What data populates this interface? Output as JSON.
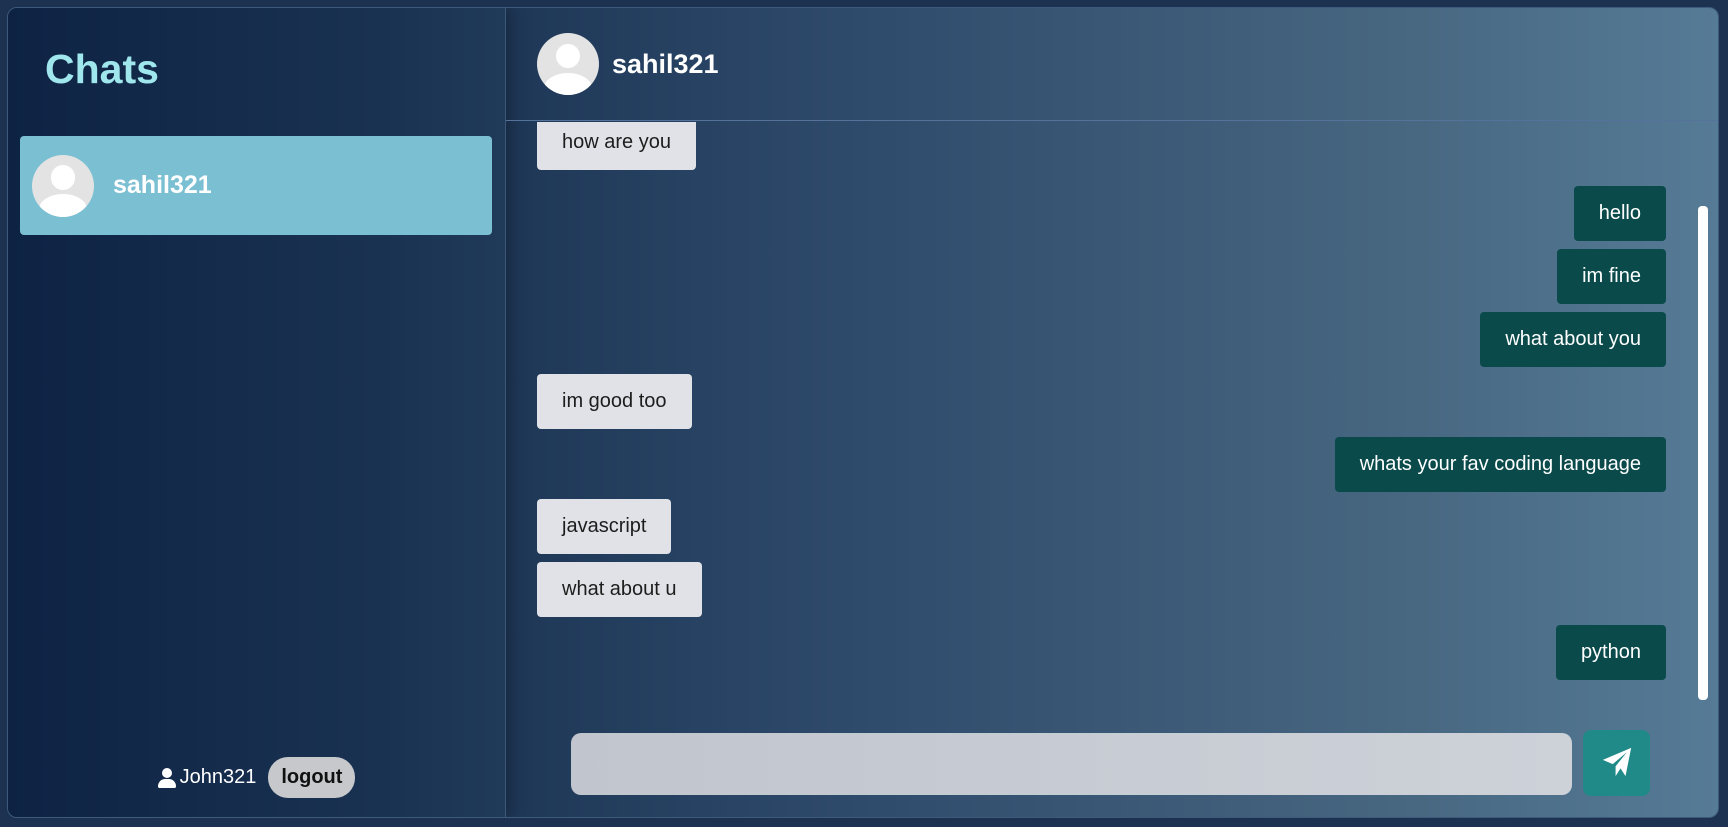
{
  "sidebar": {
    "title": "Chats",
    "chats": [
      {
        "name": "sahil321",
        "active": true
      }
    ],
    "footer": {
      "username": "John321",
      "logout_label": "logout"
    }
  },
  "conversation": {
    "contact_name": "sahil321",
    "messages": [
      {
        "direction": "in",
        "text": "how are you"
      },
      {
        "direction": "out",
        "text": "hello"
      },
      {
        "direction": "out",
        "text": "im fine"
      },
      {
        "direction": "out",
        "text": "what about you"
      },
      {
        "direction": "in",
        "text": "im good too"
      },
      {
        "direction": "out",
        "text": "whats your fav coding language"
      },
      {
        "direction": "in",
        "text": "javascript"
      },
      {
        "direction": "in",
        "text": "what about u"
      },
      {
        "direction": "out",
        "text": "python"
      }
    ],
    "composer": {
      "value": "",
      "placeholder": "",
      "send_icon": "paper-plane-icon"
    }
  },
  "colors": {
    "title_accent": "#9fe7ec",
    "active_chat": "#7bbfd3",
    "incoming_bubble": "#e0e2e7",
    "outgoing_bubble": "#0a4a4b",
    "send_button": "#1f8a88"
  }
}
